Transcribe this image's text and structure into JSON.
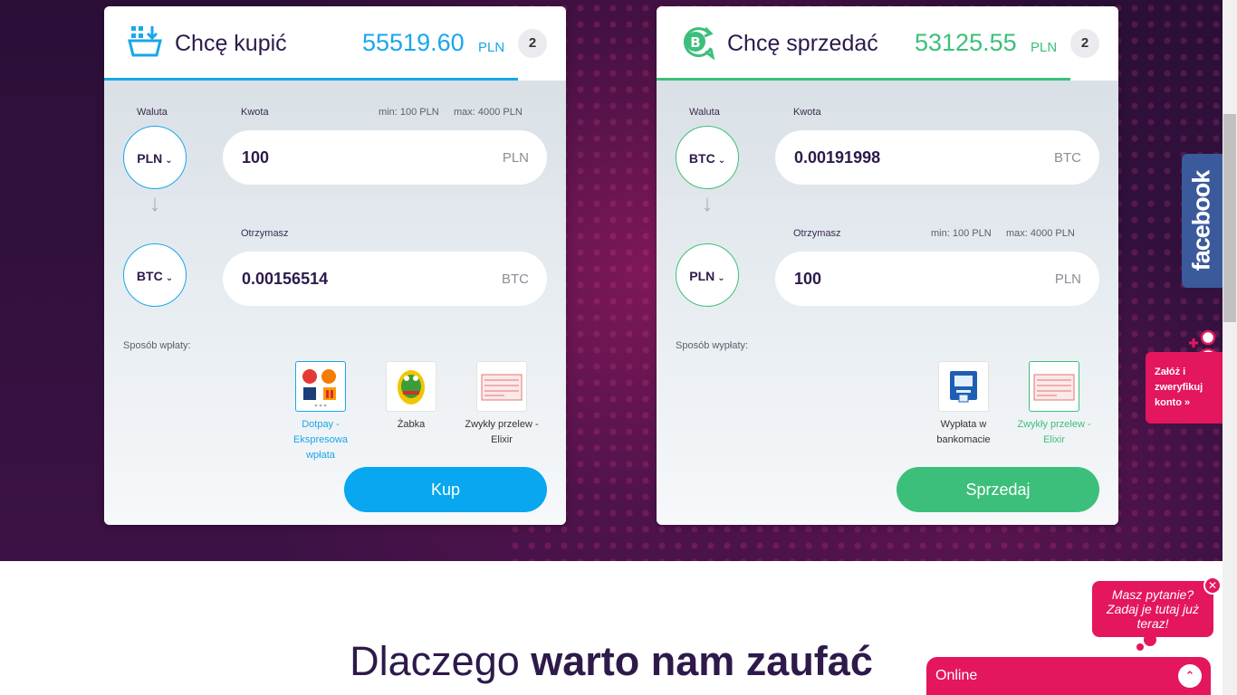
{
  "colors": {
    "buy_accent": "#1aa6ea",
    "sell_accent": "#3cbf7a",
    "brand_pink": "#e3165e",
    "facebook": "#3a5a9b",
    "dark": "#2d1a4a"
  },
  "buy": {
    "title": "Chcę kupić",
    "price": "55519.60",
    "price_currency": "PLN",
    "badge": "2",
    "currency_label": "Waluta",
    "amount_label": "Kwota",
    "min": "min: 100 PLN",
    "max": "max: 4000 PLN",
    "from_currency": "PLN",
    "amount_value": "100",
    "amount_unit": "PLN",
    "receive_label": "Otrzymasz",
    "to_currency": "BTC",
    "receive_value": "0.00156514",
    "receive_unit": "BTC",
    "method_label": "Sposób wpłaty:",
    "methods": [
      {
        "label_line1": "Dotpay -",
        "label_line2": "Ekspresowa wpłata",
        "icon": "dotpay-banks-icon"
      },
      {
        "label_line1": "Żabka",
        "label_line2": "",
        "icon": "zabka-frog-icon"
      },
      {
        "label_line1": "Zwykły przelew -",
        "label_line2": "Elixir",
        "icon": "transfer-form-icon"
      }
    ],
    "button": "Kup"
  },
  "sell": {
    "title": "Chcę sprzedać",
    "price": "53125.55",
    "price_currency": "PLN",
    "badge": "2",
    "currency_label": "Waluta",
    "amount_label": "Kwota",
    "from_currency": "BTC",
    "amount_value": "0.00191998",
    "amount_unit": "BTC",
    "receive_label": "Otrzymasz",
    "min": "min: 100 PLN",
    "max": "max: 4000 PLN",
    "to_currency": "PLN",
    "receive_value": "100",
    "receive_unit": "PLN",
    "method_label": "Sposób wypłaty:",
    "methods": [
      {
        "label_line1": "Wypłata w",
        "label_line2": "bankomacie",
        "icon": "atm-icon"
      },
      {
        "label_line1": "Zwykły przelew -",
        "label_line2": "Elixir",
        "icon": "transfer-form-icon"
      }
    ],
    "button": "Sprzedaj"
  },
  "facebook_tab": "facebook",
  "register_tab": {
    "line1": "Załóż i",
    "line2": "zweryfikuj",
    "line3": "konto"
  },
  "chat_bubble": {
    "line1": "Masz pytanie?",
    "line2": "Zadaj je tutaj już",
    "line3": "teraz!"
  },
  "chat_bar": "Online",
  "section_title_light": "Dlaczego ",
  "section_title_bold": "warto nam zaufać"
}
